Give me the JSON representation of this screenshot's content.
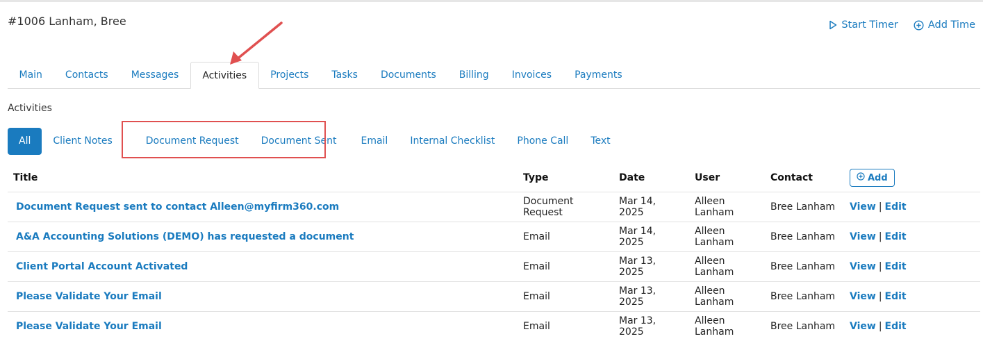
{
  "client": {
    "title": "#1006 Lanham, Bree"
  },
  "header": {
    "start_timer": "Start Timer",
    "add_time": "Add Time"
  },
  "tabs": [
    {
      "label": "Main"
    },
    {
      "label": "Contacts"
    },
    {
      "label": "Messages"
    },
    {
      "label": "Activities"
    },
    {
      "label": "Projects"
    },
    {
      "label": "Tasks"
    },
    {
      "label": "Documents"
    },
    {
      "label": "Billing"
    },
    {
      "label": "Invoices"
    },
    {
      "label": "Payments"
    }
  ],
  "active_tab": "Activities",
  "section_label": "Activities",
  "filters": [
    {
      "label": "All"
    },
    {
      "label": "Client Notes"
    },
    {
      "label": "Document Request"
    },
    {
      "label": "Document Sent"
    },
    {
      "label": "Email"
    },
    {
      "label": "Internal Checklist"
    },
    {
      "label": "Phone Call"
    },
    {
      "label": "Text"
    }
  ],
  "table": {
    "headers": {
      "title": "Title",
      "type": "Type",
      "date": "Date",
      "user": "User",
      "contact": "Contact",
      "add": "Add"
    },
    "rows": [
      {
        "title": "Document Request sent to contact Alleen@myfirm360.com",
        "type": "Document Request",
        "date": "Mar 14, 2025",
        "user": "Alleen Lanham",
        "contact": "Bree Lanham",
        "view": "View",
        "edit": "Edit"
      },
      {
        "title": "A&A Accounting Solutions (DEMO) has requested a document",
        "type": "Email",
        "date": "Mar 14, 2025",
        "user": "Alleen Lanham",
        "contact": "Bree Lanham",
        "view": "View",
        "edit": "Edit"
      },
      {
        "title": "Client Portal Account Activated",
        "type": "Email",
        "date": "Mar 13, 2025",
        "user": "Alleen Lanham",
        "contact": "Bree Lanham",
        "view": "View",
        "edit": "Edit"
      },
      {
        "title": "Please Validate Your Email",
        "type": "Email",
        "date": "Mar 13, 2025",
        "user": "Alleen Lanham",
        "contact": "Bree Lanham",
        "view": "View",
        "edit": "Edit"
      },
      {
        "title": "Please Validate Your Email",
        "type": "Email",
        "date": "Mar 13, 2025",
        "user": "Alleen Lanham",
        "contact": "Bree Lanham",
        "view": "View",
        "edit": "Edit"
      }
    ]
  },
  "colors": {
    "accent": "#1a7bbf",
    "highlight": "#e05050"
  },
  "icons": {
    "start_timer": "play-icon",
    "add_time": "plus-circle-icon",
    "add": "plus-circle-icon",
    "annotation": "arrow-icon"
  }
}
